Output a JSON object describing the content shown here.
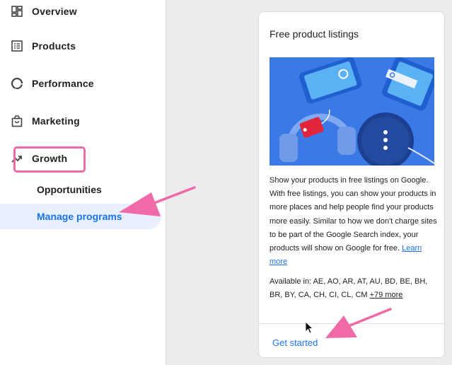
{
  "sidebar": {
    "items": [
      {
        "label": "Overview",
        "icon": "dashboard-icon"
      },
      {
        "label": "Products",
        "icon": "list-icon"
      },
      {
        "label": "Performance",
        "icon": "donut-chart-icon"
      },
      {
        "label": "Marketing",
        "icon": "shopping-bag-icon"
      },
      {
        "label": "Growth",
        "icon": "trending-up-icon"
      }
    ],
    "sub_items": [
      {
        "label": "Opportunities"
      },
      {
        "label": "Manage programs",
        "active": true
      }
    ]
  },
  "card": {
    "title": "Free product listings",
    "description": "Show your products in free listings on Google. With free listings, you can show your products in more places and help people find your products more easily. Similar to how we don't charge sites to be part of the Google Search index, your products will show on Google for free.",
    "learn_more": "Learn more",
    "available_prefix": "Available in: AE, AO, AR, AT, AU, BD, BE, BH, BR, BY, CA, CH, CI, CL, CM",
    "available_more": "+79 more",
    "cta": "Get started"
  },
  "colors": {
    "accent": "#1a73e8",
    "highlight": "#f06aa8",
    "active_bg": "#e8f0fe",
    "illustration_bg": "#3b79e6"
  }
}
